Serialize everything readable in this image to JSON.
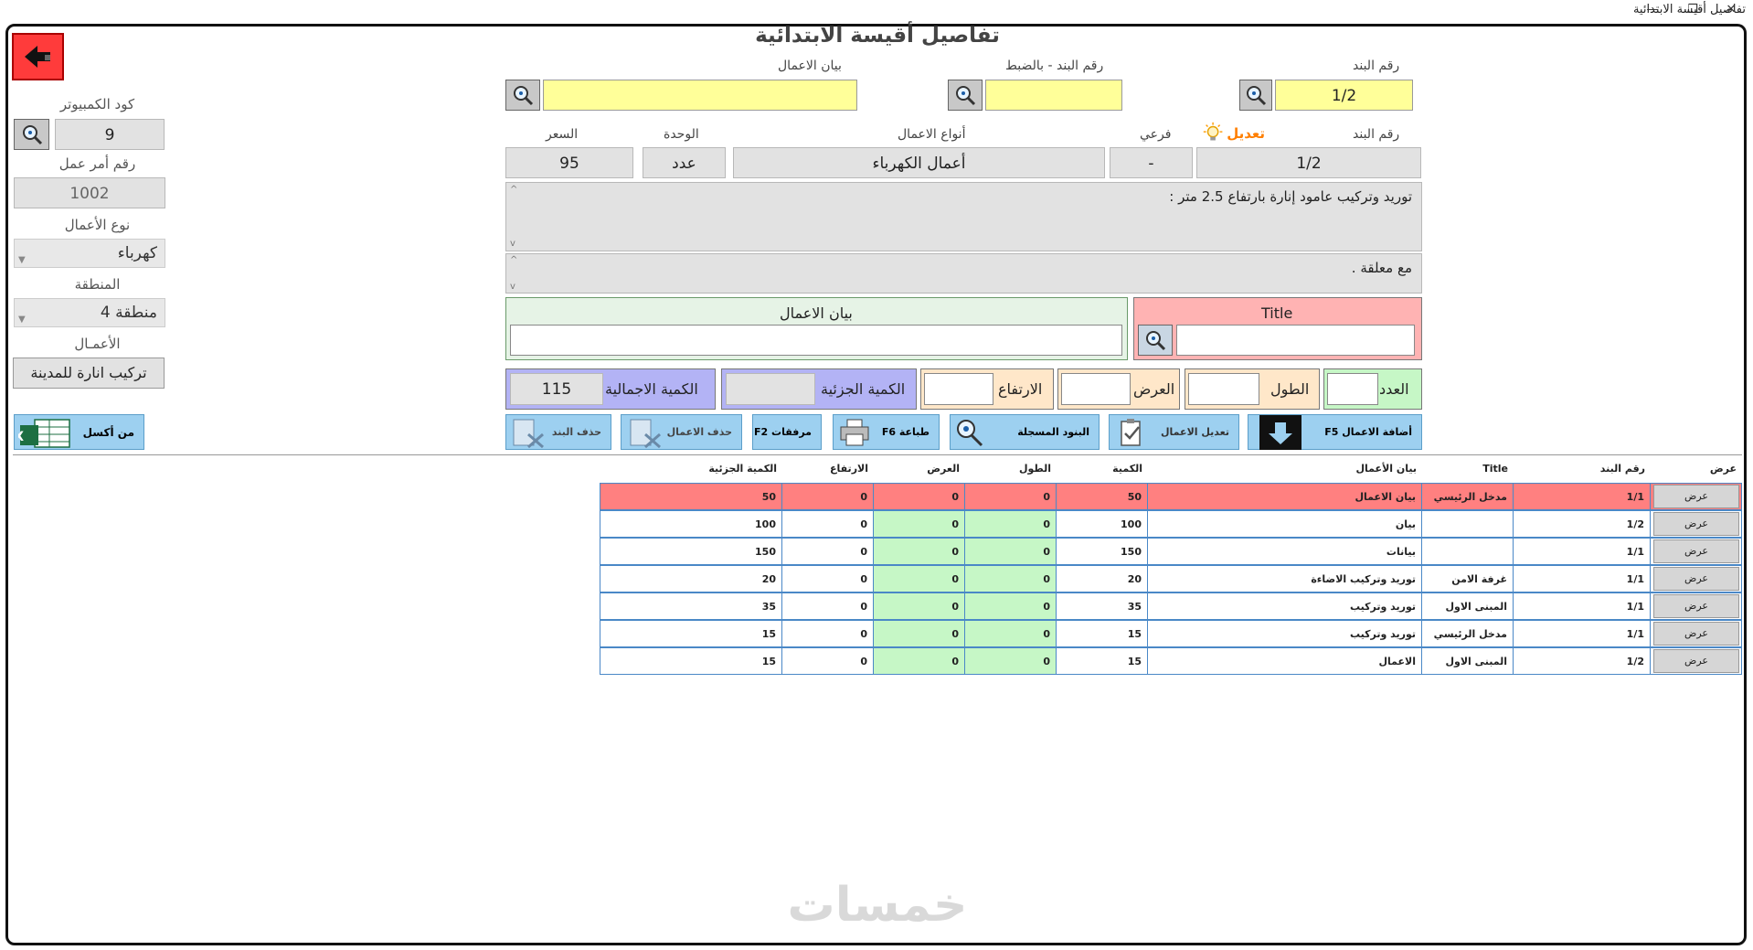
{
  "window": {
    "title": "تفاصيل أقيسة الابتدائية",
    "minimize": "—",
    "maximize": "❐",
    "close": "✕"
  },
  "page_title": "تفاصيل أقيسة الابتدائية",
  "top_search": {
    "item_no_label": "رقم البند",
    "item_no_value": "1/2",
    "exact_item_label": "رقم البند - بالضبط",
    "exact_item_value": "",
    "works_desc_label": "بيان الاعمال",
    "works_desc_value": ""
  },
  "left_panel": {
    "computer_code_label": "كود الكمبيوتر",
    "computer_code_value": "9",
    "work_order_label": "رقم أمر عمل",
    "work_order_value": "1002",
    "work_type_label": "نوع الأعمال",
    "work_type_value": "كهرباء",
    "region_label": "المنطقة",
    "region_value": "منطقة 4",
    "works_label": "الأعمـال",
    "works_value": "تركيب انارة للمدينة",
    "excel_button": "من أكسل"
  },
  "detail": {
    "item_no_label": "رقم البند",
    "edit_label": "تعديل",
    "sub_label": "فرعي",
    "work_types_label": "أنواع الاعمال",
    "unit_label": "الوحدة",
    "price_label": "السعر",
    "item_no_value": "1/2",
    "sub_value": "-",
    "work_types_value": "أعمال الكهرباء",
    "unit_value": "عدد",
    "price_value": "95",
    "description": "توريد وتركيب عامود إنارة بارتفاع 2.5 متر  :",
    "description2": "مع معلقة ."
  },
  "title_panel": {
    "label": "Title",
    "value": ""
  },
  "desc_panel": {
    "label": "بيان الاعمال",
    "value": ""
  },
  "measure": {
    "count_label": "العدد",
    "length_label": "الطول",
    "width_label": "العرض",
    "height_label": "الارتفاع",
    "partial_label": "الكمية الجزئية",
    "total_label": "الكمية الاجمالية",
    "total_value": "115"
  },
  "toolbar": {
    "add": "أضافة الاعمال F5",
    "edit": "تعديل الاعمال",
    "registered": "البنود المسجلة",
    "print": "طباعة F6",
    "attachments": "مرفقات F2",
    "delete_works": "حذف الاعمال",
    "delete_item": "حذف البند"
  },
  "table": {
    "headers": [
      "عرض",
      "رقم البند",
      "Title",
      "بيان الأعمال",
      "الكمية",
      "الطول",
      "العرض",
      "الارتفاع",
      "الكمية الجزئية"
    ],
    "view_label": "عرض",
    "rows": [
      {
        "item": "1/1",
        "title": "مدخل الرئيسي",
        "desc": "بيان الاعمال",
        "qty": "50",
        "len": "0",
        "wid": "0",
        "hei": "0",
        "part": "50"
      },
      {
        "item": "1/2",
        "title": "",
        "desc": "بيان",
        "qty": "100",
        "len": "0",
        "wid": "0",
        "hei": "0",
        "part": "100"
      },
      {
        "item": "1/1",
        "title": "",
        "desc": "بيانات",
        "qty": "150",
        "len": "0",
        "wid": "0",
        "hei": "0",
        "part": "150"
      },
      {
        "item": "1/1",
        "title": "غرفة الامن",
        "desc": "توريد وتركيب الاضاءة",
        "qty": "20",
        "len": "0",
        "wid": "0",
        "hei": "0",
        "part": "20"
      },
      {
        "item": "1/1",
        "title": "المبنى الاول",
        "desc": "توريد وتركيب",
        "qty": "35",
        "len": "0",
        "wid": "0",
        "hei": "0",
        "part": "35"
      },
      {
        "item": "1/1",
        "title": "مدخل الرئيسي",
        "desc": "توريد وتركيب",
        "qty": "15",
        "len": "0",
        "wid": "0",
        "hei": "0",
        "part": "15"
      },
      {
        "item": "1/2",
        "title": "المبنى الاول",
        "desc": "الاعمال",
        "qty": "15",
        "len": "0",
        "wid": "0",
        "hei": "0",
        "part": "15"
      }
    ]
  },
  "watermark": "خمسات",
  "colors": {
    "accent_red": "#ff8080",
    "highlight_green": "#c6f7c6",
    "button_blue": "#9dd0f0",
    "field_yellow": "#ffff99"
  }
}
